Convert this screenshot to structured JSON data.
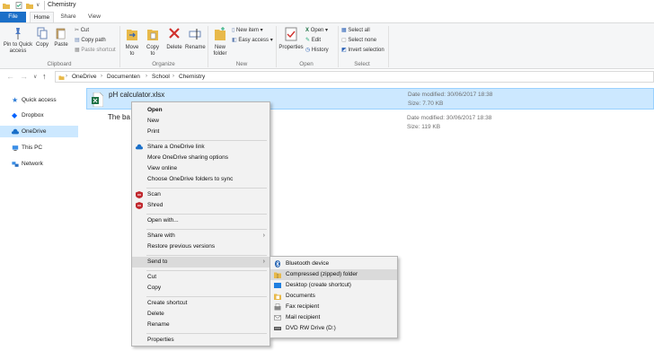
{
  "window": {
    "title": "Chemistry"
  },
  "tabs": [
    "File",
    "Home",
    "Share",
    "View"
  ],
  "ribbon": {
    "clipboard": {
      "pin": "Pin to Quick access",
      "copy": "Copy",
      "paste": "Paste",
      "cut": "Cut",
      "copy_path": "Copy path",
      "paste_shortcut": "Paste shortcut",
      "label": "Clipboard"
    },
    "organize": {
      "move_to": "Move to",
      "copy_to": "Copy to",
      "delete": "Delete",
      "rename": "Rename",
      "label": "Organize"
    },
    "new": {
      "new_folder": "New folder",
      "new_item": "New item",
      "easy_access": "Easy access",
      "label": "New"
    },
    "open": {
      "properties": "Properties",
      "open": "Open",
      "edit": "Edit",
      "history": "History",
      "label": "Open"
    },
    "select": {
      "select_all": "Select all",
      "select_none": "Select none",
      "invert": "Invert selection",
      "label": "Select"
    }
  },
  "breadcrumb": [
    "OneDrive",
    "Documenten",
    "School",
    "Chemistry"
  ],
  "sidebar": [
    "Quick access",
    "Dropbox",
    "OneDrive",
    "This PC",
    "Network"
  ],
  "files": [
    {
      "name": "pH calculator.xlsx",
      "modified": "Date modified: 30/06/2017 18:38",
      "size": "Size: 7.70 KB"
    },
    {
      "name": "The ba",
      "modified": "Date modified: 30/06/2017 18:38",
      "size": "Size: 119 KB"
    }
  ],
  "context_menu": {
    "open": "Open",
    "new": "New",
    "print": "Print",
    "share_link": "Share a OneDrive link",
    "more_sharing": "More OneDrive sharing options",
    "view_online": "View online",
    "choose_folders": "Choose OneDrive folders to sync",
    "scan": "Scan",
    "shred": "Shred",
    "open_with": "Open with...",
    "share_with": "Share with",
    "restore": "Restore previous versions",
    "send_to": "Send to",
    "cut": "Cut",
    "copy": "Copy",
    "create_shortcut": "Create shortcut",
    "delete": "Delete",
    "rename": "Rename",
    "properties": "Properties"
  },
  "send_to_menu": [
    "Bluetooth device",
    "Compressed (zipped) folder",
    "Desktop (create shortcut)",
    "Documents",
    "Fax recipient",
    "Mail recipient",
    "DVD RW Drive (D:)"
  ],
  "colors": {
    "accent": "#1a6fc8",
    "selection": "#cce8ff",
    "excel": "#1d7044",
    "ribbon_bg": "#f5f6f7"
  }
}
